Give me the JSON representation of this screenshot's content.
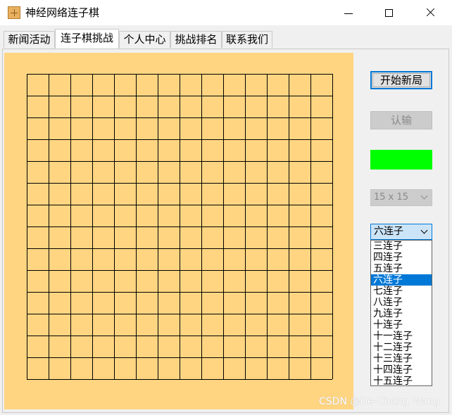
{
  "window": {
    "title": "神经网络连子棋"
  },
  "tabs": [
    {
      "label": "新闻活动",
      "active": false
    },
    {
      "label": "连子棋挑战",
      "active": true
    },
    {
      "label": "个人中心",
      "active": false
    },
    {
      "label": "挑战排名",
      "active": false
    },
    {
      "label": "联系我们",
      "active": false
    }
  ],
  "board": {
    "rows": 14,
    "cols": 14,
    "background": "#ffd581",
    "line_color": "#000000"
  },
  "controls": {
    "start_label": "开始新局",
    "surrender_label": "认输",
    "surrender_enabled": false,
    "turn_indicator_color": "#00ff00",
    "board_size_value": "15 x 15",
    "board_size_enabled": false,
    "win_rule_value": "六连子"
  },
  "win_rule_options": [
    "三连子",
    "四连子",
    "五连子",
    "六连子",
    "七连子",
    "八连子",
    "九连子",
    "十连子",
    "十一连子",
    "十二连子",
    "十三连子",
    "十四连子",
    "十五连子"
  ],
  "selected_option": "六连子",
  "watermark": "CSDN @De-Chang Wang"
}
